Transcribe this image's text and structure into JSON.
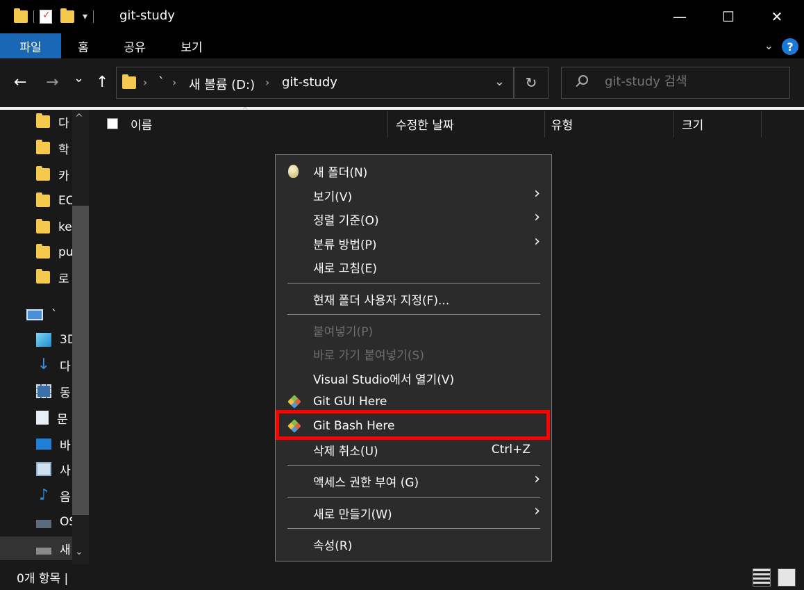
{
  "window": {
    "title": "git-study",
    "minimize_glyph": "—",
    "maximize_glyph": "☐",
    "close_glyph": "✕"
  },
  "quick_access": {
    "dropdown_glyph": "▾"
  },
  "ribbon": {
    "tabs": [
      {
        "label": "파일",
        "active": true
      },
      {
        "label": "홈"
      },
      {
        "label": "공유"
      },
      {
        "label": "보기"
      }
    ],
    "help_glyph": "?",
    "expand_glyph": "⌄"
  },
  "nav": {
    "back_glyph": "←",
    "forward_glyph": "→",
    "recent_glyph": "⌄",
    "up_glyph": "↑"
  },
  "address": {
    "crumbs": [
      "`",
      "새 볼륨 (D:)",
      "git-study"
    ],
    "separator": "›",
    "dropdown_glyph": "⌄",
    "refresh_glyph": "↻"
  },
  "search": {
    "placeholder": "git-study 검색"
  },
  "navpane": {
    "folders": [
      "다",
      "학",
      "카",
      "EC",
      "ke",
      "pu",
      "로"
    ],
    "pc_label": "`",
    "pc_items": [
      "3D",
      "다",
      "동",
      "문",
      "바",
      "사",
      "음",
      "OS",
      "새"
    ],
    "scroll_up_glyph": "^",
    "scroll_down_glyph": "⌄"
  },
  "filelist": {
    "columns": [
      "이름",
      "수정한 날짜",
      "유형",
      "크기"
    ],
    "sort_glyph": "^"
  },
  "context_menu": {
    "items": [
      {
        "label": "새 폴더(N)",
        "icon": "new-folder-icon"
      },
      {
        "label": "보기(V)",
        "submenu": true
      },
      {
        "label": "정렬 기준(O)",
        "submenu": true
      },
      {
        "label": "분류 방법(P)",
        "submenu": true
      },
      {
        "label": "새로 고침(E)"
      },
      {
        "label": "현재 폴더 사용자 지정(F)..."
      },
      {
        "label": "붙여넣기(P)",
        "disabled": true
      },
      {
        "label": "바로 가기 붙여넣기(S)",
        "disabled": true
      },
      {
        "label": "Visual Studio에서 열기(V)"
      },
      {
        "label": "Git GUI Here",
        "icon": "git-icon"
      },
      {
        "label": "Git Bash Here",
        "icon": "git-icon",
        "highlighted": true
      },
      {
        "label": "삭제 취소(U)",
        "shortcut": "Ctrl+Z"
      },
      {
        "label": "액세스 권한 부여 (G)",
        "submenu": true
      },
      {
        "label": "새로 만들기(W)",
        "submenu": true
      },
      {
        "label": "속성(R)"
      }
    ],
    "submenu_glyph": "›",
    "highlight_color": "#ff0000"
  },
  "statusbar": {
    "count_text": "0개 항목  |"
  },
  "colors": {
    "accent": "#1a67b5",
    "background": "#191919",
    "menu": "#2b2b2b",
    "folder": "#f4c94d"
  }
}
